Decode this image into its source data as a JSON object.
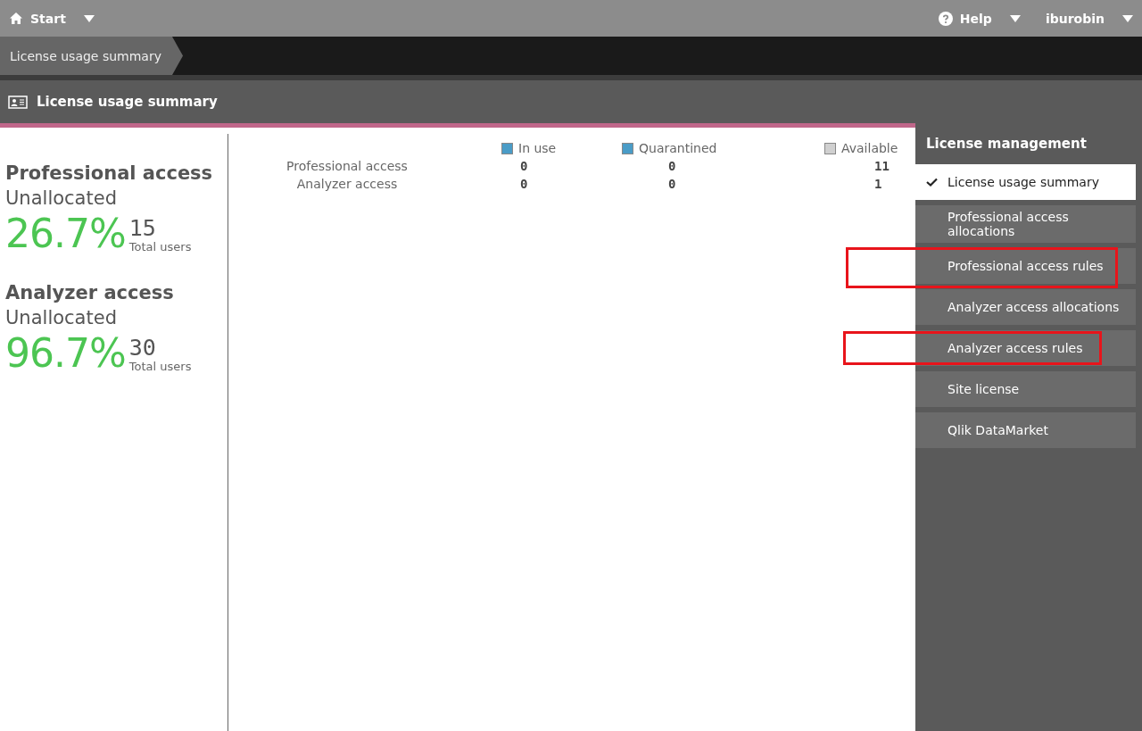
{
  "top_bar": {
    "start": "Start",
    "help": "Help",
    "user": "iburobin"
  },
  "breadcrumb": [
    "License usage summary"
  ],
  "page_title": "License usage summary",
  "stats": [
    {
      "title": "Professional access",
      "subtitle": "Unallocated",
      "percent": "26.7%",
      "total": "15",
      "total_label": "Total users"
    },
    {
      "title": "Analyzer access",
      "subtitle": "Unallocated",
      "percent": "96.7%",
      "total": "30",
      "total_label": "Total users"
    }
  ],
  "table": {
    "columns": [
      {
        "label": "In use",
        "color": "#4a9cc7"
      },
      {
        "label": "Quarantined",
        "color": "#4a9cc7"
      },
      {
        "label": "Available",
        "color": "#d0d0d0"
      }
    ],
    "rows": [
      {
        "label": "Professional access",
        "values": [
          "0",
          "0",
          "11"
        ]
      },
      {
        "label": "Analyzer access",
        "values": [
          "0",
          "0",
          "1"
        ]
      }
    ]
  },
  "sidebar": {
    "title": "License management",
    "items": [
      {
        "label": "License usage summary",
        "selected": true,
        "annotated": false
      },
      {
        "label": "Professional access allocations",
        "selected": false,
        "annotated": false
      },
      {
        "label": "Professional access rules",
        "selected": false,
        "annotated": true
      },
      {
        "label": "Analyzer access allocations",
        "selected": false,
        "annotated": false
      },
      {
        "label": "Analyzer access rules",
        "selected": false,
        "annotated": true
      },
      {
        "label": "Site license",
        "selected": false,
        "annotated": false
      },
      {
        "label": "Qlik DataMarket",
        "selected": false,
        "annotated": false
      }
    ]
  }
}
